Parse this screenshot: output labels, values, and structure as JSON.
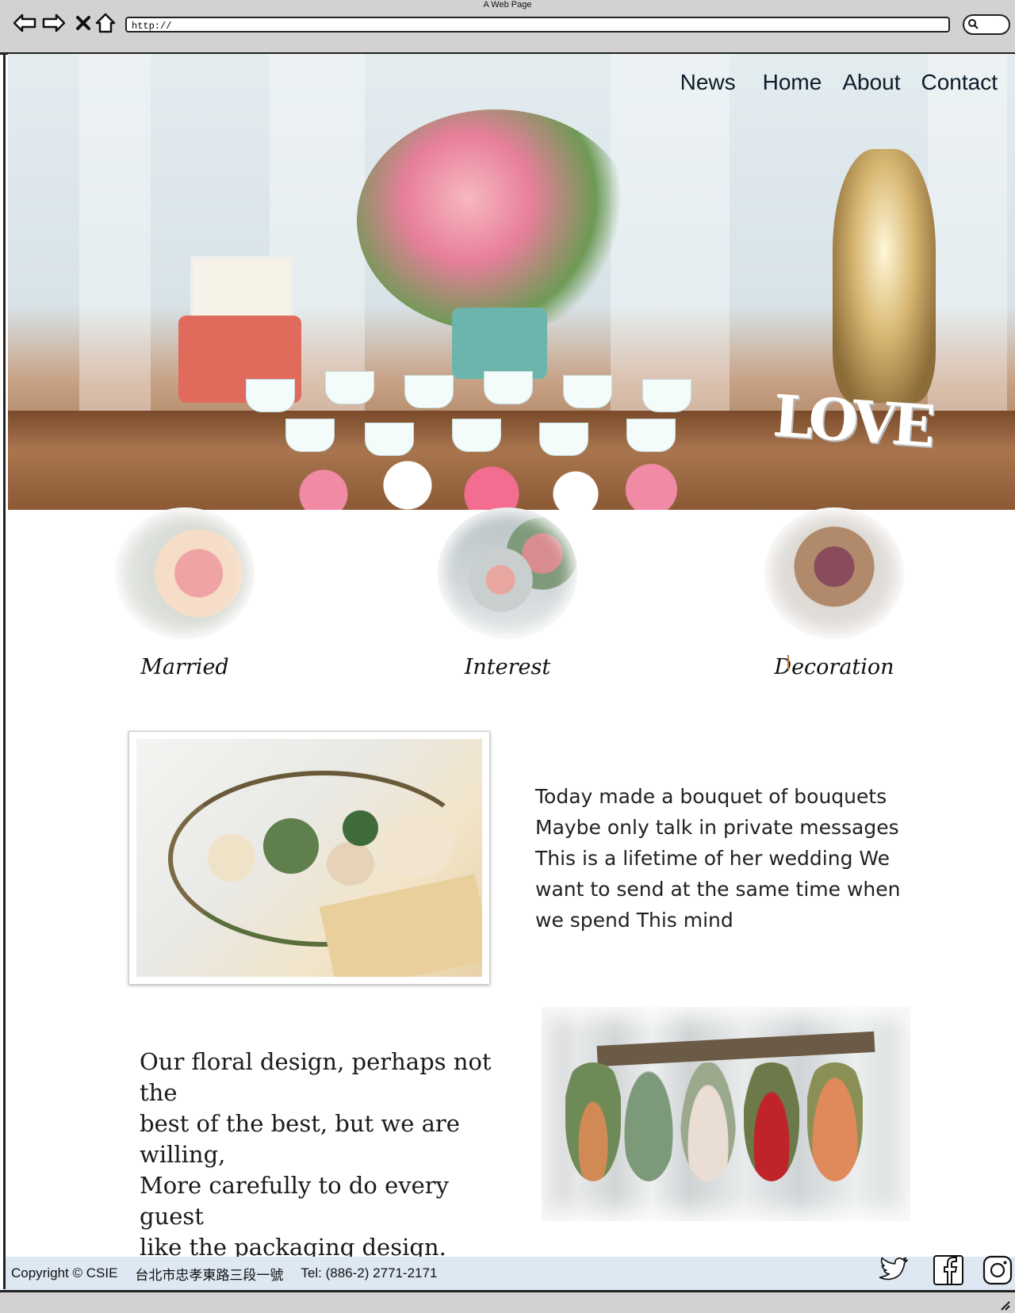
{
  "window": {
    "title": "A Web Page"
  },
  "browser": {
    "url": "http://"
  },
  "nav": {
    "items": [
      "News",
      "Home",
      "About",
      "Contact"
    ]
  },
  "hero": {
    "love_text": "LOVE"
  },
  "categories": [
    {
      "label": "Married"
    },
    {
      "label": "Interest"
    },
    {
      "label": "Decoration"
    }
  ],
  "section1": {
    "lines": [
      "Today made a bouquet of bouquets",
      "Maybe only talk in private messages",
      "This is a lifetime of her wedding We",
      "want to send at the same time when",
      "we spend This mind"
    ]
  },
  "section2": {
    "lines": [
      "Our floral design, perhaps not the",
      "best of the best, but we are willing,",
      "More carefully to do every guest",
      "like the packaging design."
    ]
  },
  "footer": {
    "copyright": "Copyright © CSIE",
    "address": "台北市忠孝東路三段一號",
    "tel": "Tel: (886-2) 2771-2171"
  },
  "social_icons": [
    "twitter-icon",
    "facebook-icon",
    "instagram-icon"
  ]
}
